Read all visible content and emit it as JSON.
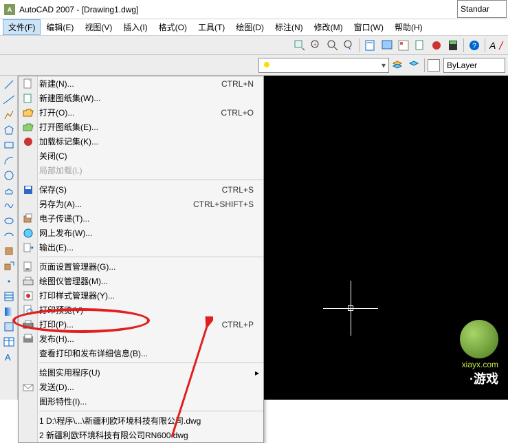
{
  "title": "AutoCAD 2007 - [Drawing1.dwg]",
  "menubar": {
    "items": [
      {
        "label": "文件(F)",
        "active": true
      },
      {
        "label": "编辑(E)"
      },
      {
        "label": "视图(V)"
      },
      {
        "label": "插入(I)"
      },
      {
        "label": "格式(O)"
      },
      {
        "label": "工具(T)"
      },
      {
        "label": "绘图(D)"
      },
      {
        "label": "标注(N)"
      },
      {
        "label": "修改(M)"
      },
      {
        "label": "窗口(W)"
      },
      {
        "label": "帮助(H)"
      }
    ]
  },
  "file_menu": {
    "items": [
      {
        "label": "新建(N)...",
        "shortcut": "CTRL+N",
        "icon": "new-doc"
      },
      {
        "label": "新建图纸集(W)...",
        "icon": "new-sheetset"
      },
      {
        "label": "打开(O)...",
        "shortcut": "CTRL+O",
        "icon": "open"
      },
      {
        "label": "打开图纸集(E)...",
        "icon": "open-sheetset"
      },
      {
        "label": "加载标记集(K)...",
        "icon": "load-markup"
      },
      {
        "label": "关闭(C)"
      },
      {
        "label": "局部加载(L)",
        "disabled": true
      },
      {
        "sep": true
      },
      {
        "label": "保存(S)",
        "shortcut": "CTRL+S",
        "icon": "save"
      },
      {
        "label": "另存为(A)...",
        "shortcut": "CTRL+SHIFT+S"
      },
      {
        "label": "电子传递(T)...",
        "icon": "etransmit"
      },
      {
        "label": "网上发布(W)...",
        "icon": "web-publish"
      },
      {
        "label": "输出(E)...",
        "icon": "export"
      },
      {
        "sep": true
      },
      {
        "label": "页面设置管理器(G)...",
        "icon": "page-setup"
      },
      {
        "label": "绘图仪管理器(M)...",
        "icon": "plotter-mgr",
        "highlighted": true
      },
      {
        "label": "打印样式管理器(Y)...",
        "icon": "plotstyle-mgr"
      },
      {
        "label": "打印预览(V)",
        "icon": "print-preview"
      },
      {
        "label": "打印(P)...",
        "shortcut": "CTRL+P",
        "icon": "print"
      },
      {
        "label": "发布(H)...",
        "icon": "publish"
      },
      {
        "label": "查看打印和发布详细信息(B)..."
      },
      {
        "sep": true
      },
      {
        "label": "绘图实用程序(U)",
        "submenu": true
      },
      {
        "label": "发送(D)...",
        "icon": "send"
      },
      {
        "label": "图形特性(I)..."
      },
      {
        "sep": true
      },
      {
        "label": "1 D:\\程序\\...\\新疆利欧环境科技有限公司.dwg"
      },
      {
        "label": "2 新疆利欧环境科技有限公司RN600.dwg"
      }
    ]
  },
  "right_tools": {
    "style_label": "Standar"
  },
  "layer_panel": {
    "combo_value": "",
    "bylayer": "ByLayer"
  },
  "watermark": {
    "url": "xiayx.com",
    "name": "·游戏"
  }
}
